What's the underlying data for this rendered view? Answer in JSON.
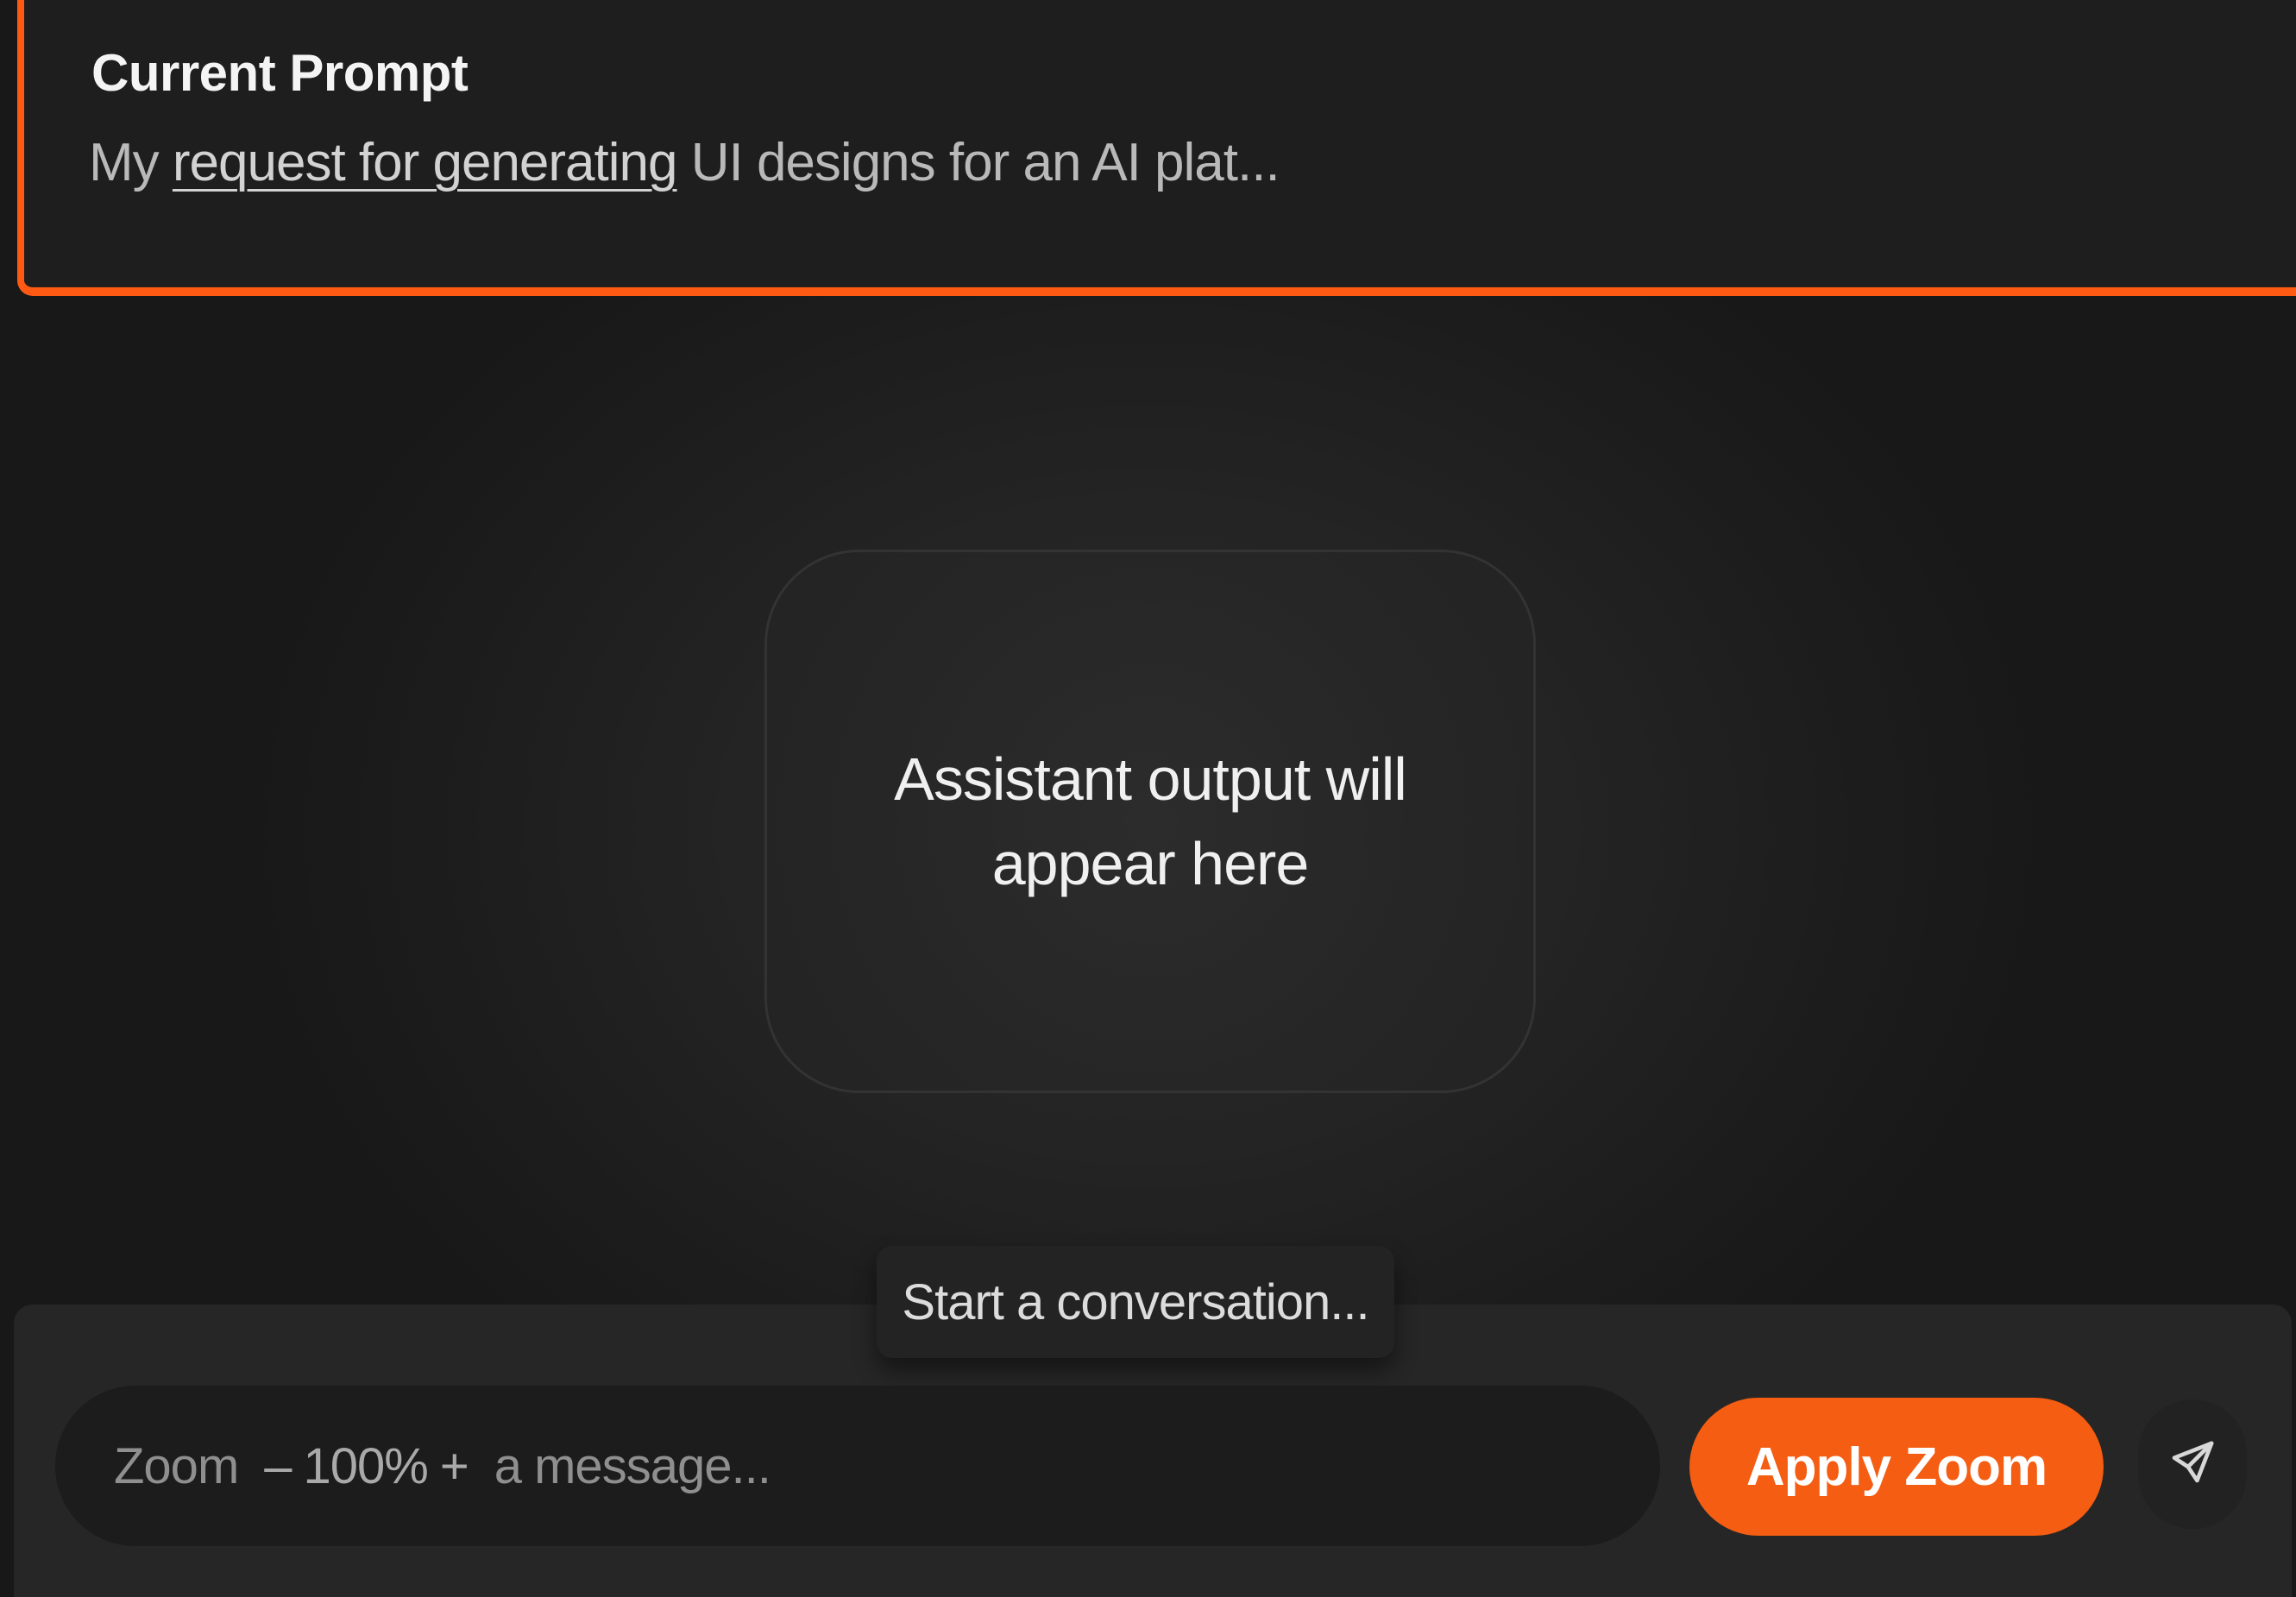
{
  "prompt_panel": {
    "title": "Current Prompt",
    "text_prefix": "My ",
    "text_linked": "request for generating",
    "text_suffix": " UI designs for an AI plat..."
  },
  "output_card": {
    "placeholder": "Assistant output will appear here"
  },
  "composer": {
    "tooltip": "Start a conversation...",
    "input_prefix": "Zoom",
    "zoom_minus": "–",
    "zoom_value": "100%",
    "zoom_plus": "+",
    "input_suffix": "a message...",
    "apply_zoom_label": "Apply Zoom",
    "send_icon": "paper-plane-icon"
  },
  "colors": {
    "accent": "#f45d12",
    "background": "#1b1b1b",
    "panel": "#1e1e1e"
  }
}
